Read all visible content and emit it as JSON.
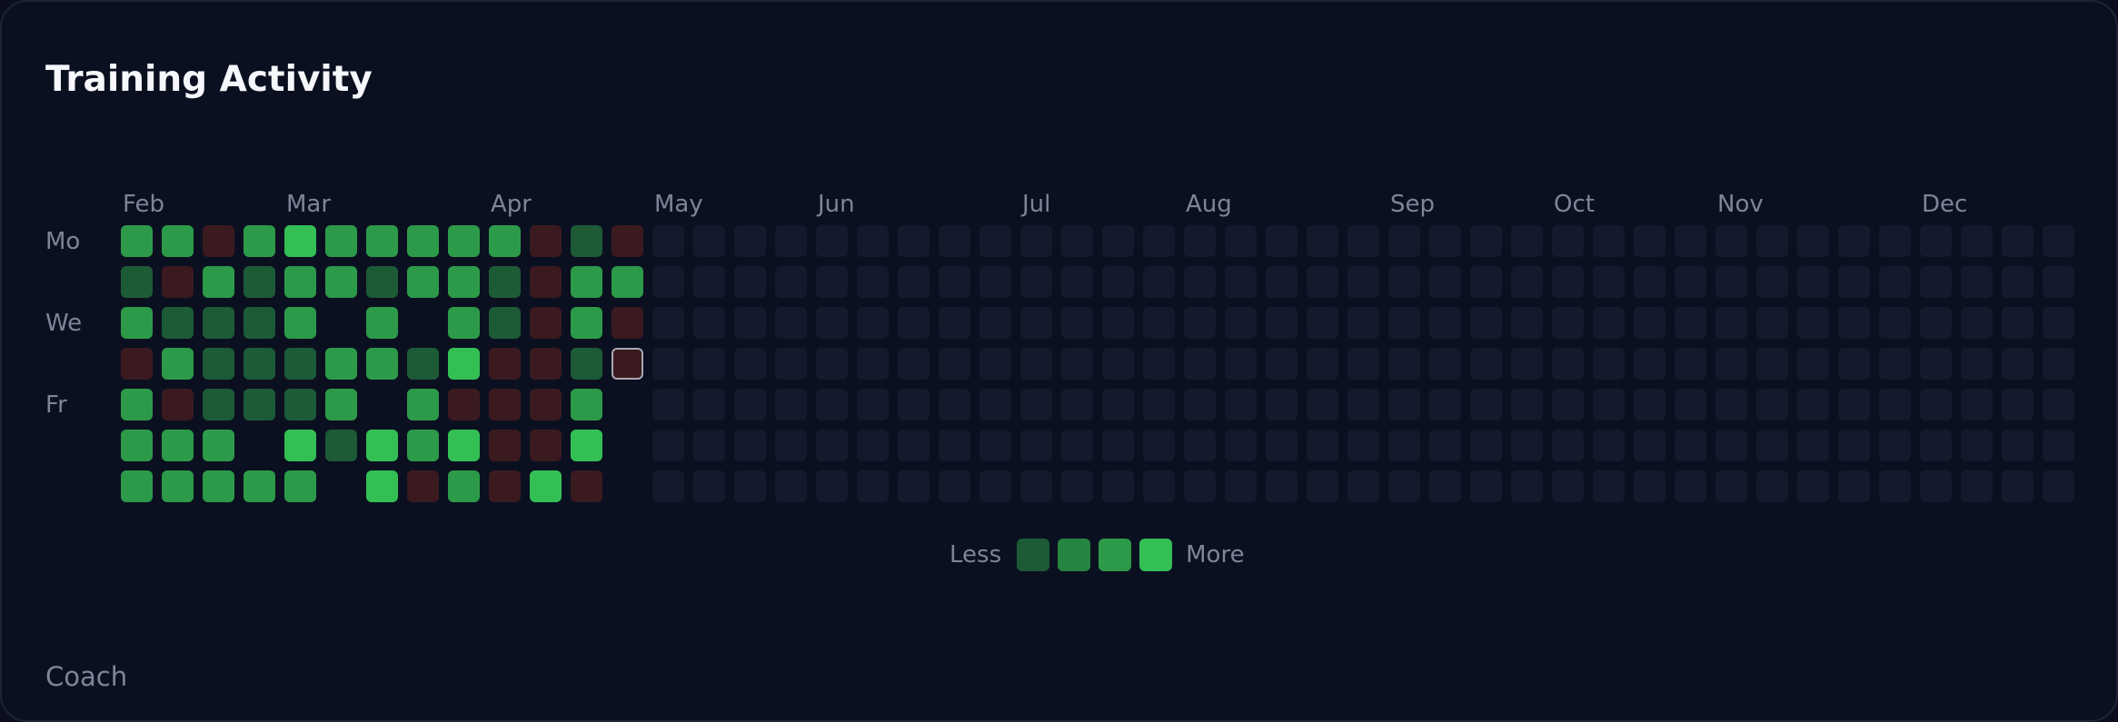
{
  "widget": {
    "title": "Training Activity",
    "footer": "Coach"
  },
  "months": [
    {
      "label": "Feb",
      "col": 0
    },
    {
      "label": "Mar",
      "col": 4
    },
    {
      "label": "Apr",
      "col": 9
    },
    {
      "label": "May",
      "col": 13
    },
    {
      "label": "Jun",
      "col": 17
    },
    {
      "label": "Jul",
      "col": 22
    },
    {
      "label": "Aug",
      "col": 26
    },
    {
      "label": "Sep",
      "col": 31
    },
    {
      "label": "Oct",
      "col": 35
    },
    {
      "label": "Nov",
      "col": 39
    },
    {
      "label": "Dec",
      "col": 44
    }
  ],
  "day_labels": [
    {
      "label": "Mo",
      "row": 0
    },
    {
      "label": "We",
      "row": 2
    },
    {
      "label": "Fr",
      "row": 4
    }
  ],
  "legend": {
    "less_label": "Less",
    "more_label": "More",
    "swatches": [
      "#1d5a36",
      "#25843f",
      "#2c9a49",
      "#34bf55"
    ]
  },
  "colors": {
    "background": "#0b1020",
    "empty": "#121a2b",
    "missed": "#3b1a1f",
    "level1": "#1d5a36",
    "level2": "#25843f",
    "level3": "#2c9a49",
    "level4": "#34bf55"
  },
  "activity": {
    "total_weeks": 48,
    "today": {
      "col": 12,
      "row": 3
    },
    "weeks": [
      [
        "l3",
        "l1",
        "l3",
        "m",
        "l3",
        "l3",
        "l3"
      ],
      [
        "l3",
        "m",
        "l1",
        "l3",
        "m",
        "l3",
        "l3"
      ],
      [
        "m",
        "l3",
        "l1",
        "l1",
        "l1",
        "l3",
        "l3"
      ],
      [
        "l3",
        "l1",
        "l1",
        "l1",
        "l1",
        "n",
        "l3"
      ],
      [
        "l4",
        "l3",
        "l3",
        "l1",
        "l1",
        "l4",
        "l3"
      ],
      [
        "l3",
        "l3",
        "n",
        "l3",
        "l3",
        "l1",
        "n"
      ],
      [
        "l3",
        "l1",
        "l3",
        "l3",
        "n",
        "l4",
        "l4"
      ],
      [
        "l3",
        "l3",
        "n",
        "l1",
        "l3",
        "l3",
        "m"
      ],
      [
        "l3",
        "l3",
        "l3",
        "l4",
        "m",
        "l4",
        "l3"
      ],
      [
        "l3",
        "l1",
        "l1",
        "m",
        "m",
        "m",
        "m"
      ],
      [
        "m",
        "m",
        "m",
        "m",
        "m",
        "m",
        "l4"
      ],
      [
        "l1",
        "l3",
        "l3",
        "l1",
        "l3",
        "l4",
        "m"
      ],
      [
        "m",
        "l3",
        "m",
        "t",
        "n",
        "n",
        "n"
      ]
    ]
  }
}
